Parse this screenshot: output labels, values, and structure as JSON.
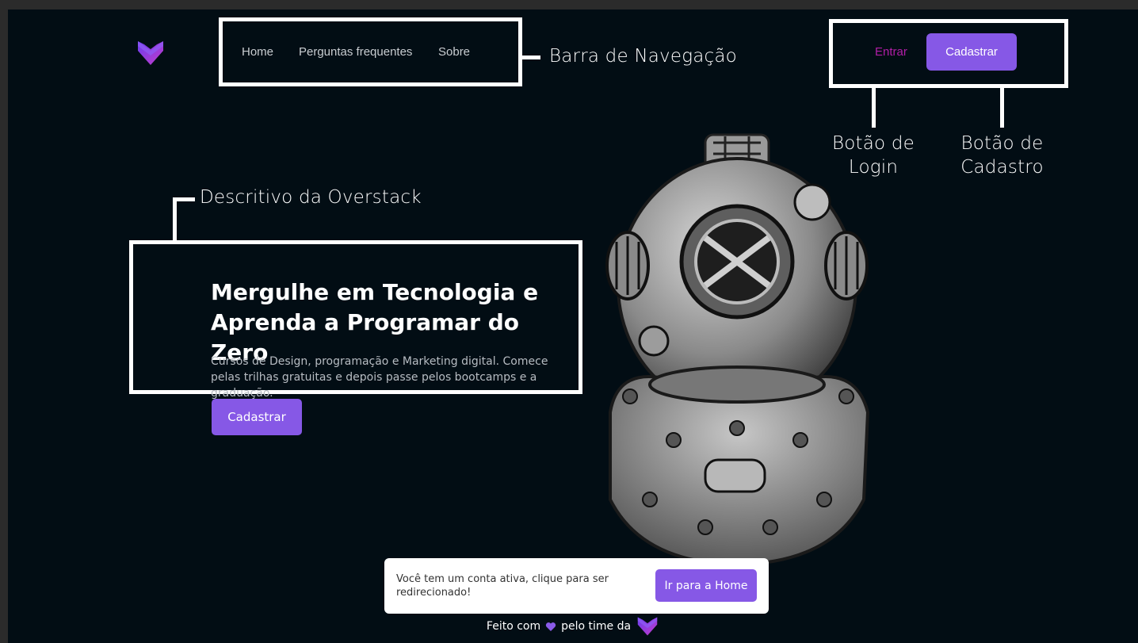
{
  "nav": {
    "links": [
      "Home",
      "Perguntas frequentes",
      "Sobre"
    ],
    "login_label": "Entrar",
    "signup_label": "Cadastrar"
  },
  "annotations": {
    "navbar": "Barra de Navegação",
    "login_button": "Botão de Login",
    "signup_button": "Botão de Cadastro",
    "description": "Descritivo da Overstack"
  },
  "hero": {
    "title": "Mergulhe em Tecnologia e Aprenda a Programar do Zero",
    "subtitle": "Cursos de Design, programação e Marketing digital. Comece pelas trilhas gratuitas e depois passe pelos bootcamps e a graduação.",
    "cta_label": "Cadastrar"
  },
  "toast": {
    "message": "Você tem um conta ativa, clique para ser redirecionado!",
    "button_label": "Ir para a Home"
  },
  "footer": {
    "prefix": "Feito com",
    "suffix": "pelo time da"
  },
  "colors": {
    "background": "#020d14",
    "accent": "#8658e6",
    "login_link": "#b21ea8"
  },
  "icons": {
    "logo": "overstack-chevron-logo",
    "heart": "heart-icon",
    "illustration": "diving-helmet"
  }
}
